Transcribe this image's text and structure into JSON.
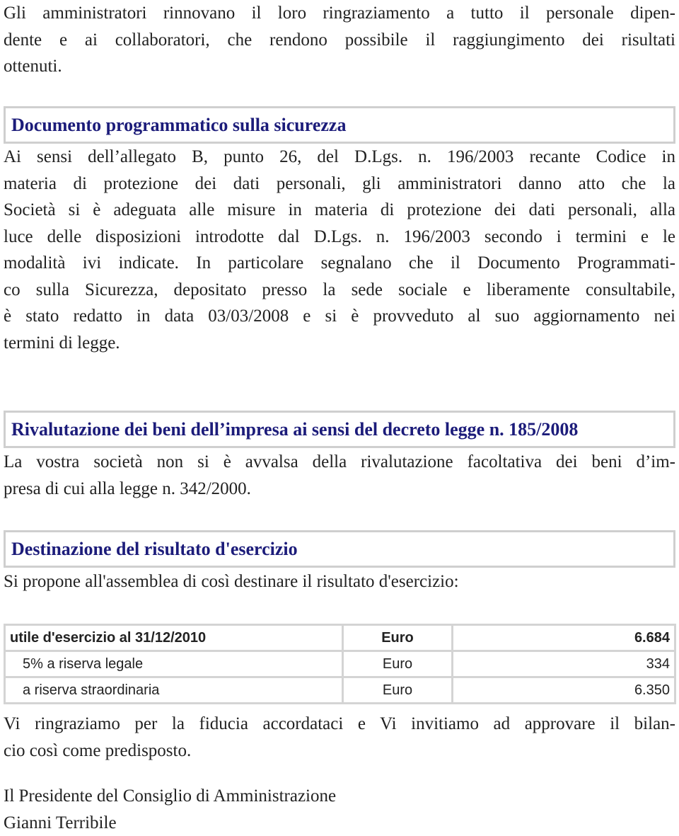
{
  "intro": [
    "Gli amministratori rinnovano il loro ringraziamento a tutto il personale dipen-",
    "dente e ai collaboratori, che rendono possibile il raggiungimento dei risultati",
    "ottenuti."
  ],
  "sections": [
    {
      "title": "Documento programmatico sulla sicurezza",
      "lines": [
        "Ai sensi dell’allegato B, punto 26, del D.Lgs. n. 196/2003 recante Codice in",
        "materia di protezione dei dati personali, gli amministratori danno atto che la",
        "Società si è adeguata alle misure in materia di protezione dei dati personali, alla",
        "luce delle disposizioni introdotte dal D.Lgs. n. 196/2003 secondo i termini e le",
        "modalità ivi indicate. In particolare segnalano che il Documento Programmati-",
        "co sulla Sicurezza, depositato presso la sede sociale e liberamente consultabile,",
        "è stato redatto in data 03/03/2008 e si è provveduto al suo aggiornamento nei",
        "termini di legge."
      ]
    },
    {
      "title": "Rivalutazione dei beni dell’impresa ai sensi del decreto legge n. 185/2008",
      "lines": [
        "La vostra società non si è avvalsa della rivalutazione facoltativa dei beni d’im-",
        "presa di cui alla legge n. 342/2000."
      ]
    },
    {
      "title": "Destinazione del risultato d'esercizio",
      "lines": [
        "Si propone all'assemblea di così destinare il risultato d'esercizio:"
      ]
    }
  ],
  "table": [
    [
      "utile d'esercizio al 31/12/2010",
      "Euro",
      "6.684"
    ],
    [
      "5% a riserva legale",
      "Euro",
      "334"
    ],
    [
      "a riserva straordinaria",
      "Euro",
      "6.350"
    ]
  ],
  "closing": [
    "Vi ringraziamo per la fiducia accordataci e Vi invitiamo ad approvare il bilan-",
    "cio così come predisposto."
  ],
  "signature": [
    "Il Presidente del Consiglio di Amministrazione",
    "Gianni Terribile"
  ]
}
